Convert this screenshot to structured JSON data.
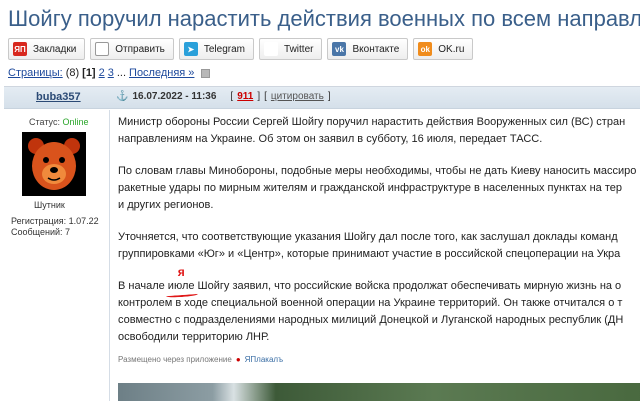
{
  "title": "Шойгу поручил нарастить действия военных по всем направлениям на Ук",
  "share": [
    {
      "label": "Закладки",
      "icon": "yap-icon",
      "glyph": "ЯП"
    },
    {
      "label": "Отправить",
      "icon": "mail-icon",
      "glyph": "✉"
    },
    {
      "label": "Telegram",
      "icon": "telegram-icon",
      "glyph": "➤"
    },
    {
      "label": "Twitter",
      "icon": "twitter-icon",
      "glyph": "t"
    },
    {
      "label": "Вконтакте",
      "icon": "vk-icon",
      "glyph": "vk"
    },
    {
      "label": "OK.ru",
      "icon": "ok-icon",
      "glyph": "ok"
    }
  ],
  "pages": {
    "label": "Страницы:",
    "count": "(8)",
    "current": "[1]",
    "p2": "2",
    "p3": "3",
    "ellipsis": "...",
    "last": "Последняя »"
  },
  "post": {
    "author": "buba357",
    "anchor": "⚓",
    "date": "16.07.2022 - 11:36",
    "number": "911",
    "quote": "цитировать",
    "status_label": "Статус:",
    "status_value": "Online",
    "avatar_caption": "Шутник",
    "registration": "Регистрация: 1.07.22",
    "messages": "Сообщений: 7",
    "p1_l1": "Министр обороны России Сергей Шойгу поручил нарастить действия Вооруженных сил (ВС) стран",
    "p1_l2": "направлениям на Украине. Об этом он заявил в субботу, 16 июля, передает ТАСС.",
    "p2_l1": "По словам главы Минобороны, подобные меры необходимы, чтобы не дать Киеву наносить массиро",
    "p2_l2": "ракетные удары по мирным жителям и гражданской инфраструктуре в населенных пунктах на тер",
    "p2_l3": "и других регионов.",
    "p3_l1": "Уточняется, что соответствующие указания Шойгу дал после того, как заслушал доклады команд",
    "p3_l2": "группировками «Юг» и «Центр», которые принимают участие в российской спецоперации на Укра",
    "p4_l1_a": "В начале ",
    "p4_l1_word": "июле",
    "p4_l1_b": " Шойгу заявил, что российские войска продолжат обеспечивать мирную жизнь на о",
    "p4_fix": "я",
    "p4_l2": "контролем в ходе специальной военной операции на Украине территорий. Он также отчитался о т",
    "p4_l3": "совместно с подразделениями народных милиций Донецкой и Луганской народных республик (ДН",
    "p4_l4": "освободили территорию ЛНР.",
    "app_note": "Размещено через приложение",
    "app_name": "ЯПлакалъ"
  },
  "colors": {
    "title": "#3a5f8a",
    "link": "#1e4a9c",
    "online": "#2aa52a",
    "annotation": "#e01818"
  }
}
